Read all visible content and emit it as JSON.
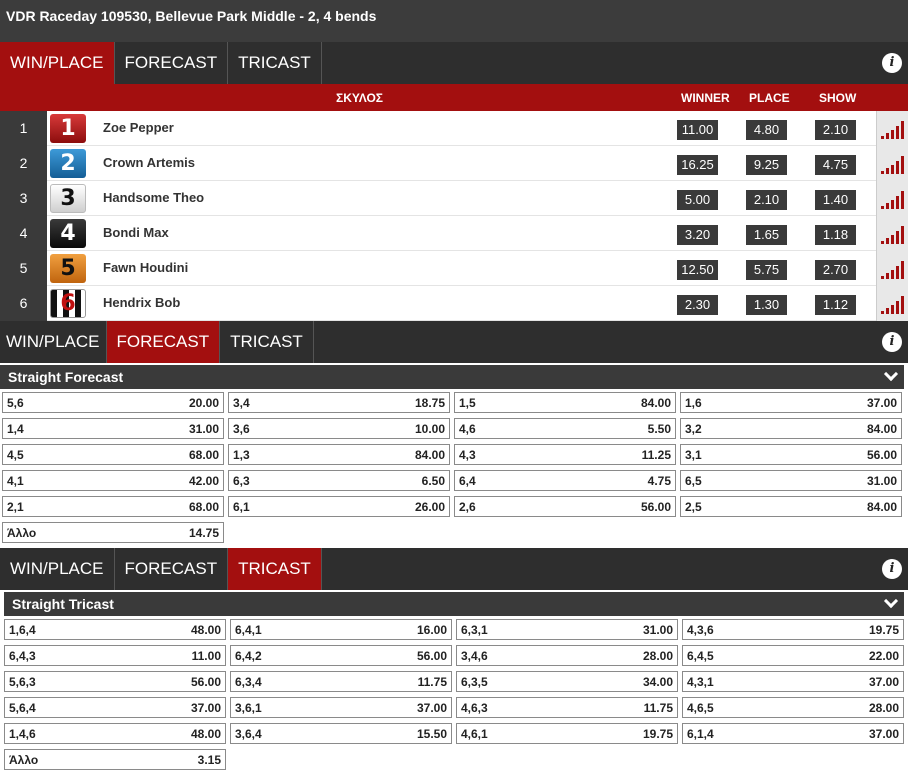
{
  "race_title": "VDR Raceday 109530, Bellevue Park Middle - 2, 4 bends",
  "tabs": [
    "WIN/PLACE",
    "FORECAST",
    "TRICAST"
  ],
  "info_label": "i",
  "winplace": {
    "columns": {
      "dog": "ΣΚΥΛΟΣ",
      "winner": "WINNER",
      "place": "PLACE",
      "show": "SHOW"
    },
    "runners": [
      {
        "num": "1",
        "trap": "1",
        "name": "Zoe Pepper",
        "winner": "11.00",
        "place": "4.80",
        "show": "2.10"
      },
      {
        "num": "2",
        "trap": "2",
        "name": "Crown Artemis",
        "winner": "16.25",
        "place": "9.25",
        "show": "4.75"
      },
      {
        "num": "3",
        "trap": "3",
        "name": "Handsome Theo",
        "winner": "5.00",
        "place": "2.10",
        "show": "1.40"
      },
      {
        "num": "4",
        "trap": "4",
        "name": "Bondi Max",
        "winner": "3.20",
        "place": "1.65",
        "show": "1.18"
      },
      {
        "num": "5",
        "trap": "5",
        "name": "Fawn Houdini",
        "winner": "12.50",
        "place": "5.75",
        "show": "2.70"
      },
      {
        "num": "6",
        "trap": "6",
        "name": "Hendrix Bob",
        "winner": "2.30",
        "place": "1.30",
        "show": "1.12"
      }
    ]
  },
  "forecast": {
    "market": "Straight Forecast",
    "cells": [
      {
        "c": "5,6",
        "o": "20.00"
      },
      {
        "c": "3,4",
        "o": "18.75"
      },
      {
        "c": "1,5",
        "o": "84.00"
      },
      {
        "c": "1,6",
        "o": "37.00"
      },
      {
        "c": "1,4",
        "o": "31.00"
      },
      {
        "c": "3,6",
        "o": "10.00"
      },
      {
        "c": "4,6",
        "o": "5.50"
      },
      {
        "c": "3,2",
        "o": "84.00"
      },
      {
        "c": "4,5",
        "o": "68.00"
      },
      {
        "c": "1,3",
        "o": "84.00"
      },
      {
        "c": "4,3",
        "o": "11.25"
      },
      {
        "c": "3,1",
        "o": "56.00"
      },
      {
        "c": "4,1",
        "o": "42.00"
      },
      {
        "c": "6,3",
        "o": "6.50"
      },
      {
        "c": "6,4",
        "o": "4.75"
      },
      {
        "c": "6,5",
        "o": "31.00"
      },
      {
        "c": "2,1",
        "o": "68.00"
      },
      {
        "c": "6,1",
        "o": "26.00"
      },
      {
        "c": "2,6",
        "o": "56.00"
      },
      {
        "c": "2,5",
        "o": "84.00"
      },
      {
        "c": "Άλλο",
        "o": "14.75"
      }
    ]
  },
  "tricast": {
    "market": "Straight Tricast",
    "cells": [
      {
        "c": "1,6,4",
        "o": "48.00"
      },
      {
        "c": "6,4,1",
        "o": "16.00"
      },
      {
        "c": "6,3,1",
        "o": "31.00"
      },
      {
        "c": "4,3,6",
        "o": "19.75"
      },
      {
        "c": "6,4,3",
        "o": "11.00"
      },
      {
        "c": "6,4,2",
        "o": "56.00"
      },
      {
        "c": "3,4,6",
        "o": "28.00"
      },
      {
        "c": "6,4,5",
        "o": "22.00"
      },
      {
        "c": "5,6,3",
        "o": "56.00"
      },
      {
        "c": "6,3,4",
        "o": "11.75"
      },
      {
        "c": "6,3,5",
        "o": "34.00"
      },
      {
        "c": "4,3,1",
        "o": "37.00"
      },
      {
        "c": "5,6,4",
        "o": "37.00"
      },
      {
        "c": "3,6,1",
        "o": "37.00"
      },
      {
        "c": "4,6,3",
        "o": "11.75"
      },
      {
        "c": "4,6,5",
        "o": "28.00"
      },
      {
        "c": "1,4,6",
        "o": "48.00"
      },
      {
        "c": "3,6,4",
        "o": "15.50"
      },
      {
        "c": "4,6,1",
        "o": "19.75"
      },
      {
        "c": "6,1,4",
        "o": "37.00"
      },
      {
        "c": "Άλλο",
        "o": "3.15"
      }
    ]
  },
  "colors": {
    "accent": "#a30f0f",
    "dark": "#2e2e2e"
  },
  "icons": {
    "info": "info-icon",
    "chevron": "chevron-down-icon",
    "stats": "stats-bars-icon"
  }
}
